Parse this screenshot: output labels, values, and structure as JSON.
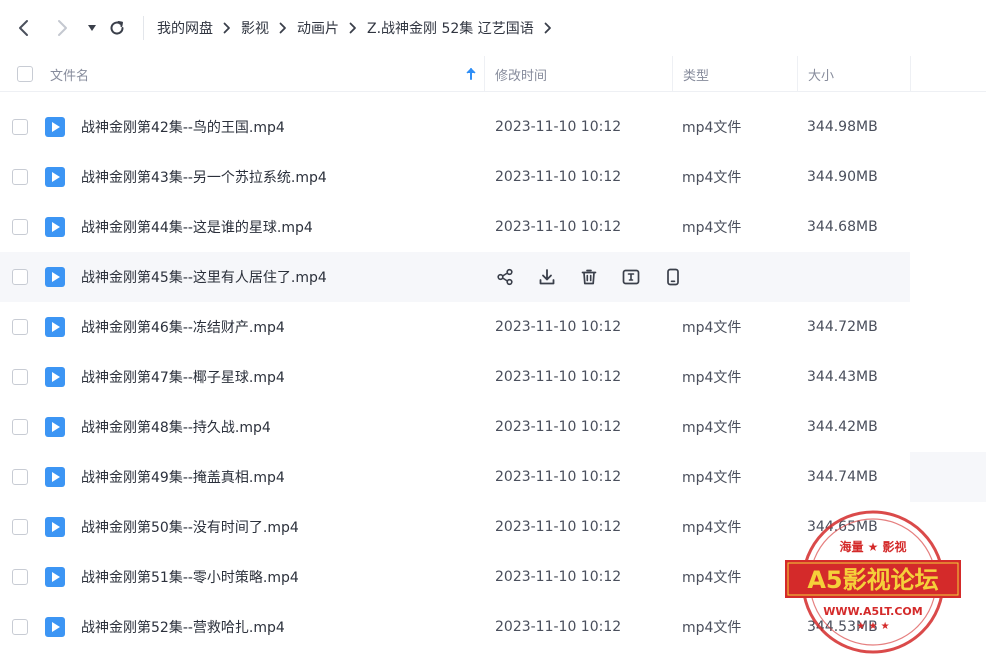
{
  "breadcrumb": [
    "我的网盘",
    "影视",
    "动画片",
    "Z.战神金刚 52集 辽艺国语"
  ],
  "header": {
    "name": "文件名",
    "mtime": "修改时间",
    "type": "类型",
    "size": "大小"
  },
  "rows": [
    {
      "name": "战神金刚第42集--鸟的王国.mp4",
      "mtime": "2023-11-10 10:12",
      "type": "mp4文件",
      "size": "344.98MB"
    },
    {
      "name": "战神金刚第43集--另一个苏拉系统.mp4",
      "mtime": "2023-11-10 10:12",
      "type": "mp4文件",
      "size": "344.90MB"
    },
    {
      "name": "战神金刚第44集--这是谁的星球.mp4",
      "mtime": "2023-11-10 10:12",
      "type": "mp4文件",
      "size": "344.68MB"
    },
    {
      "name": "战神金刚第45集--这里有人居住了.mp4",
      "mtime": "",
      "type": "",
      "size": ""
    },
    {
      "name": "战神金刚第46集--冻结财产.mp4",
      "mtime": "2023-11-10 10:12",
      "type": "mp4文件",
      "size": "344.72MB"
    },
    {
      "name": "战神金刚第47集--椰子星球.mp4",
      "mtime": "2023-11-10 10:12",
      "type": "mp4文件",
      "size": "344.43MB"
    },
    {
      "name": "战神金刚第48集--持久战.mp4",
      "mtime": "2023-11-10 10:12",
      "type": "mp4文件",
      "size": "344.42MB"
    },
    {
      "name": "战神金刚第49集--掩盖真相.mp4",
      "mtime": "2023-11-10 10:12",
      "type": "mp4文件",
      "size": "344.74MB"
    },
    {
      "name": "战神金刚第50集--没有时间了.mp4",
      "mtime": "2023-11-10 10:12",
      "type": "mp4文件",
      "size": "344.65MB"
    },
    {
      "name": "战神金刚第51集--零小时策略.mp4",
      "mtime": "2023-11-10 10:12",
      "type": "mp4文件",
      "size": "344.58MB"
    },
    {
      "name": "战神金刚第52集--营救哈扎.mp4",
      "mtime": "2023-11-10 10:12",
      "type": "mp4文件",
      "size": "344.53MB"
    }
  ],
  "hover_actions": [
    "share-icon",
    "download-icon",
    "delete-icon",
    "rename-icon",
    "phone-icon"
  ],
  "watermark": {
    "top": "海量 ★ 影视",
    "main": "A5影视论坛",
    "url": "WWW.A5LT.COM"
  },
  "colors": {
    "accent": "#2f8ef6",
    "file_icon": "#3c95f4",
    "stamp_red": "#d42a2a",
    "stamp_text": "#f5d03a"
  }
}
